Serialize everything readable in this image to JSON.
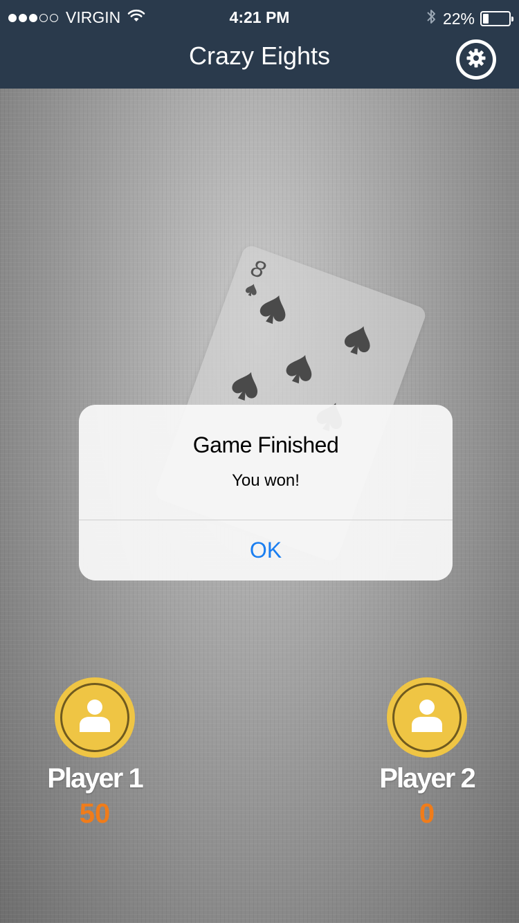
{
  "status_bar": {
    "carrier": "VIRGIN",
    "signal_bars_filled": 3,
    "signal_bars_total": 5,
    "time": "4:21 PM",
    "battery_percent": "22%",
    "battery_level": 0.22
  },
  "nav": {
    "title": "Crazy Eights",
    "settings_icon": "gear-icon"
  },
  "table": {
    "card": {
      "rank": "8",
      "suit": "spades"
    }
  },
  "players": [
    {
      "name": "Player 1",
      "score": "50",
      "avatar_icon": "user-icon"
    },
    {
      "name": "Player 2",
      "score": "0",
      "avatar_icon": "user-icon"
    }
  ],
  "alert": {
    "title": "Game Finished",
    "message": "You won!",
    "ok_label": "OK"
  },
  "colors": {
    "nav_background": "#2a3a4c",
    "avatar": "#efc544",
    "score": "#f07c1a",
    "alert_button": "#1a7ef0"
  }
}
